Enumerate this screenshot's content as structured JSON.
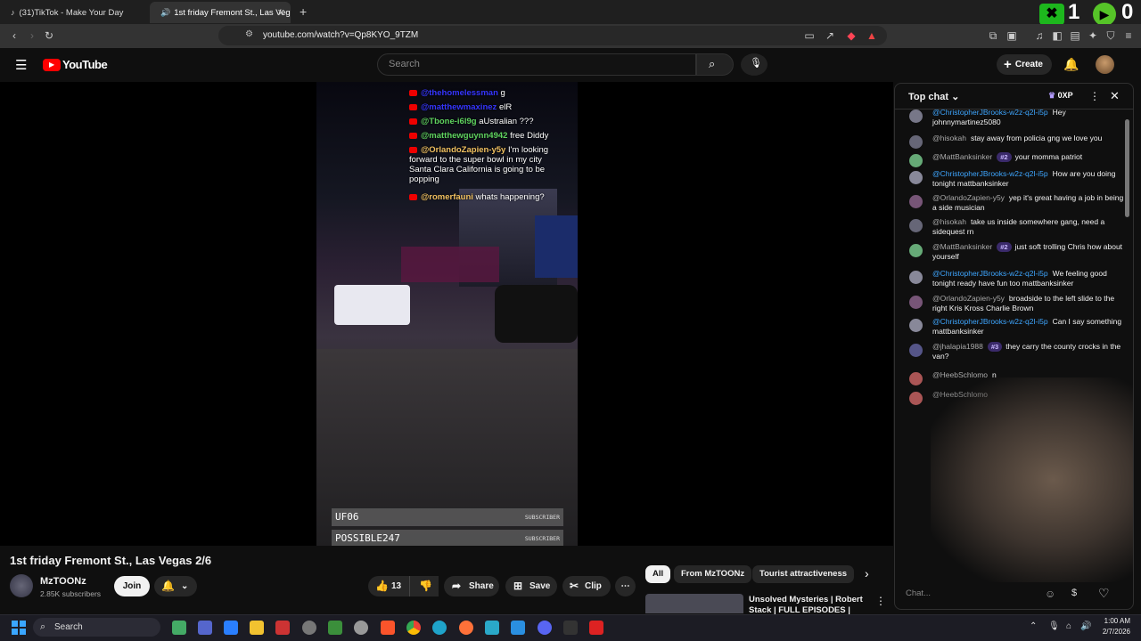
{
  "browser": {
    "tabs": [
      {
        "label": "(31)TikTok - Make Your Day"
      },
      {
        "label": "1st friday Fremont St., Las Veg"
      }
    ],
    "url": "youtube.com/watch?v=Qp8KYO_9TZM",
    "new_tab": "+"
  },
  "overlay_counter": {
    "left": "1",
    "right": "0"
  },
  "youtube": {
    "logo_text": "YouTube",
    "search_placeholder": "Search",
    "create_label": "Create"
  },
  "video_overlay": {
    "lines": [
      {
        "user": "@thehomelessman",
        "text": "g"
      },
      {
        "user": "@matthewmaxinez",
        "text": "elR"
      },
      {
        "user": "@Tbone-i6l9g",
        "text": "aUstralian ???"
      },
      {
        "user": "@matthewguynn4942",
        "text": "free Diddy"
      },
      {
        "user": "@OrlandoZapien-y5y",
        "text": "I'm looking forward to the super bowl in my city Santa Clara California is going to be popping"
      },
      {
        "user": "@romerfauni",
        "text": "whats happening?"
      }
    ],
    "subscriber_tags": [
      {
        "name": "UF06",
        "tag": "SUBSCRIBER"
      },
      {
        "name": "POSSIBLE247",
        "tag": "SUBSCRIBER"
      }
    ]
  },
  "video": {
    "title": "1st friday Fremont St., Las Vegas 2/6",
    "channel": "MzTOONz",
    "subscribers": "2.85K subscribers",
    "join_label": "Join",
    "likes": "13",
    "share_label": "Share",
    "save_label": "Save",
    "clip_label": "Clip"
  },
  "chips": [
    "All",
    "From MzTOONz",
    "Tourist attractiveness"
  ],
  "recommendation": {
    "title": "Unsolved Mysteries | Robert Stack | FULL EPISODES |"
  },
  "chat": {
    "header": "Top chat",
    "points": "0XP",
    "input_placeholder": "Chat...",
    "messages": [
      {
        "user": "@ChristopherJBrooks-w2z-q2l-i5p",
        "text": "Hey johnnymartinez5080",
        "style": "blue"
      },
      {
        "user": "@hisokah",
        "text": "stay away from policia gng we love you",
        "style": "plain"
      },
      {
        "user": "@MattBanksinker",
        "badge": "#2",
        "text": "your momma patriot",
        "style": "plain"
      },
      {
        "user": "@ChristopherJBrooks-w2z-q2l-i5p",
        "text": "How are you doing tonight mattbanksinker",
        "style": "blue"
      },
      {
        "user": "@OrlandoZapien-y5y",
        "text": "yep it's great having a job in being a side musician",
        "style": "plain"
      },
      {
        "user": "@hisokah",
        "text": "take us inside somewhere gang, need a sidequest rn",
        "style": "plain"
      },
      {
        "user": "@MattBanksinker",
        "badge": "#2",
        "text": "just soft trolling Chris how about yourself",
        "style": "plain"
      },
      {
        "user": "@ChristopherJBrooks-w2z-q2l-i5p",
        "text": "We feeling good tonight ready have fun too mattbanksinker",
        "style": "blue"
      },
      {
        "user": "@OrlandoZapien-y5y",
        "text": "broadside to the left slide to the right Kris Kross Charlie Brown",
        "style": "plain"
      },
      {
        "user": "@ChristopherJBrooks-w2z-q2l-i5p",
        "text": "Can I say something mattbanksinker",
        "style": "blue"
      },
      {
        "user": "@jhalapia1988",
        "badge": "#3",
        "text": "they carry the county crocks in the van?",
        "style": "plain"
      },
      {
        "user": "@HeebSchlomo",
        "text": "n",
        "style": "plain"
      },
      {
        "user": "@HeebSchlomo",
        "text": "",
        "style": "plain"
      }
    ]
  },
  "taskbar": {
    "search_label": "Search",
    "time": "1:00 AM",
    "date": "2/7/2026"
  }
}
